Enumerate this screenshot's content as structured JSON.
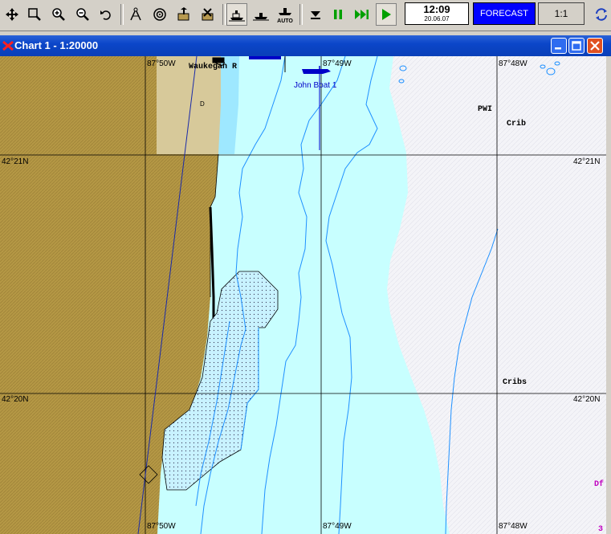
{
  "toolbar": {
    "auto_label": "AUTO",
    "clock_time": "12:09",
    "clock_date": "20.06.07",
    "forecast_label": "FORECAST",
    "scale_value": "1:1"
  },
  "window": {
    "title": "Chart 1 - 1:20000"
  },
  "chart": {
    "lon_labels_top": [
      "87°50W",
      "87°49W",
      "87°48W"
    ],
    "lon_labels_bottom": [
      "87°50W",
      "87°49W",
      "87°48W"
    ],
    "lat_labels_left": [
      "42°21N",
      "42°20N"
    ],
    "lat_labels_right": [
      "42°21N",
      "42°20N"
    ],
    "place_label": "Waukegan R",
    "vessel_label": "John Boat 1",
    "label_pwi": "PWI",
    "label_crib": "Crib",
    "label_cribs": "Cribs",
    "label_df": "Df",
    "label_3": "3",
    "label_d": "D",
    "colors": {
      "land": "#b59845",
      "shallow_water": "#c8ffff",
      "deep_water": "#f4f4f8",
      "grid": "#000080",
      "depth_contour": "#1e90ff",
      "vessel": "#0000c8"
    }
  }
}
